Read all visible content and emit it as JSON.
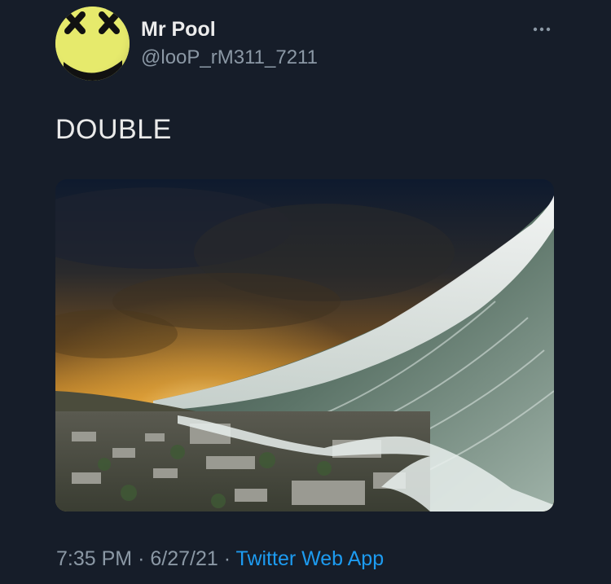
{
  "tweet": {
    "author": {
      "display_name": "Mr Pool",
      "handle": "@looP_rM311_7211",
      "avatar_icon": "yellow-smiley-face-icon"
    },
    "more_icon": "more-horizontal-icon",
    "text": "DOUBLE",
    "media": {
      "type": "image",
      "description_icon": "tsunami-wave-image"
    },
    "meta": {
      "time": "7:35 PM",
      "separator": "·",
      "date": "6/27/21",
      "source": "Twitter Web App"
    }
  },
  "colors": {
    "background": "#161d29",
    "primary_text": "#e7e9ea",
    "secondary_text": "#8b98a5",
    "link": "#1d9bf0"
  }
}
